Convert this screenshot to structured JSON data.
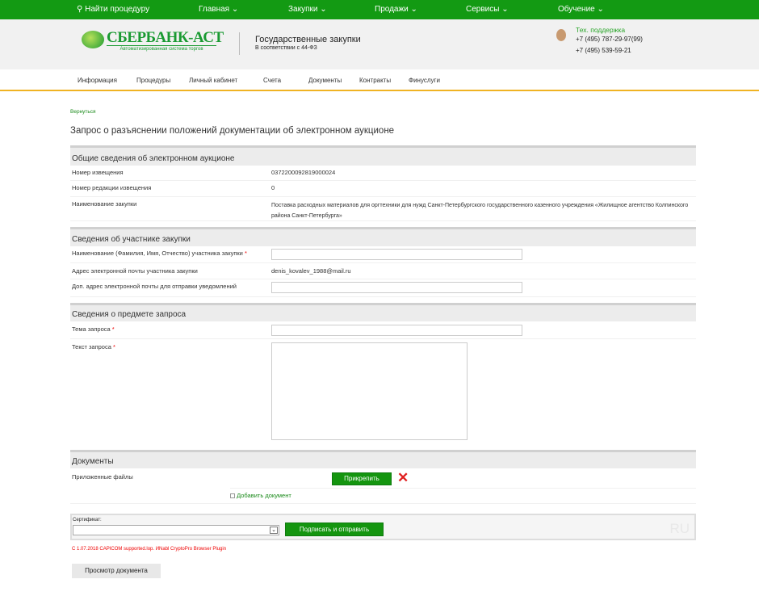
{
  "topnav": {
    "search": "Найти процедуру",
    "items": [
      "Главная",
      "Закупки",
      "Продажи",
      "Сервисы",
      "Обучение"
    ]
  },
  "header": {
    "logo": "СБЕРБАНК-АСТ",
    "logo_sub": "Автоматизированная система торгов",
    "title": "Государственные закупки",
    "subtitle": "В соответствии с 44-ФЗ",
    "support_label": "Тех. поддержка",
    "phone1": "+7 (495) 787-29-97(99)",
    "phone2": "+7 (495) 539-59-21"
  },
  "subnav": [
    "Информация",
    "Процедуры",
    "Личный кабинет",
    "Счета",
    "Документы",
    "Контракты",
    "Финуслуги"
  ],
  "back": "Вернуться",
  "page_title": "Запрос о разъяснении положений документации об электронном аукционе",
  "s1": {
    "title": "Общие сведения об электронном аукционе",
    "rows": [
      {
        "label": "Номер извещения",
        "value": "0372200092819000024"
      },
      {
        "label": "Номер редакции извещения",
        "value": "0"
      },
      {
        "label": "Наименование закупки",
        "value": "Поставка расходных материалов для оргтехники для нужд Санкт-Петербургского государственного казенного учреждения «Жилищное агентство Колпинского района Санкт-Петербурга»"
      }
    ]
  },
  "s2": {
    "title": "Сведения об участнике закупки",
    "name_label": "Наименование (Фамилия, Имя, Отчество) участника закупки",
    "email_label": "Адрес электронной почты участника закупки",
    "email_value": "denis_kovalev_1988@mail.ru",
    "extra_email_label": "Доп. адрес электронной почты для отправки уведомлений",
    "name_value": "",
    "extra_email_value": ""
  },
  "s3": {
    "title": "Сведения о предмете запроса",
    "subject_label": "Тема запроса",
    "text_label": "Текст запроса",
    "subject_value": "",
    "text_value": ""
  },
  "s4": {
    "title": "Документы",
    "files_label": "Приложенные файлы",
    "attach": "Прикрепить",
    "add_doc": "Добавить документ"
  },
  "cert": {
    "label": "Сертификат:",
    "selected": "",
    "sign": "Подписать и отправить",
    "watermark": "RU"
  },
  "notice": "С 1.07.2018 CAPICOM supported.lop. ИNabl CryptoPro Browser Plugin",
  "view_doc": "Просмотр документа",
  "required_mark": "*"
}
